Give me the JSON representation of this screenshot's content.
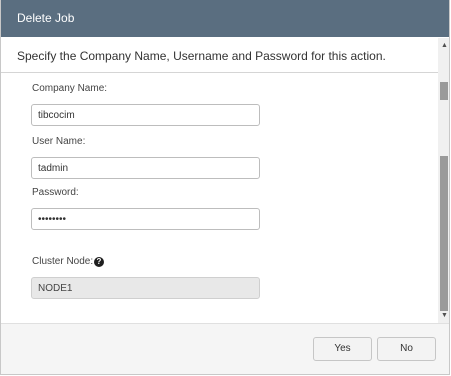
{
  "dialog": {
    "title": "Delete Job",
    "instruction": "Specify the Company Name, Username and Password for this action."
  },
  "form": {
    "company_name_label": "Company Name:",
    "company_name_value": "tibcocim",
    "user_name_label": "User Name:",
    "user_name_value": "tadmin",
    "password_label": "Password:",
    "password_value": "••••••••",
    "cluster_node_label": "Cluster Node:",
    "cluster_node_value": "NODE1",
    "help_icon_glyph": "?"
  },
  "scrollbar": {
    "up_arrow": "▲",
    "down_arrow": "▼"
  },
  "footer": {
    "yes_label": "Yes",
    "no_label": "No"
  },
  "colors": {
    "titlebar": "#5a6e80",
    "footer_background": "#f5f5f5",
    "readonly_field": "#e8e8e8"
  }
}
